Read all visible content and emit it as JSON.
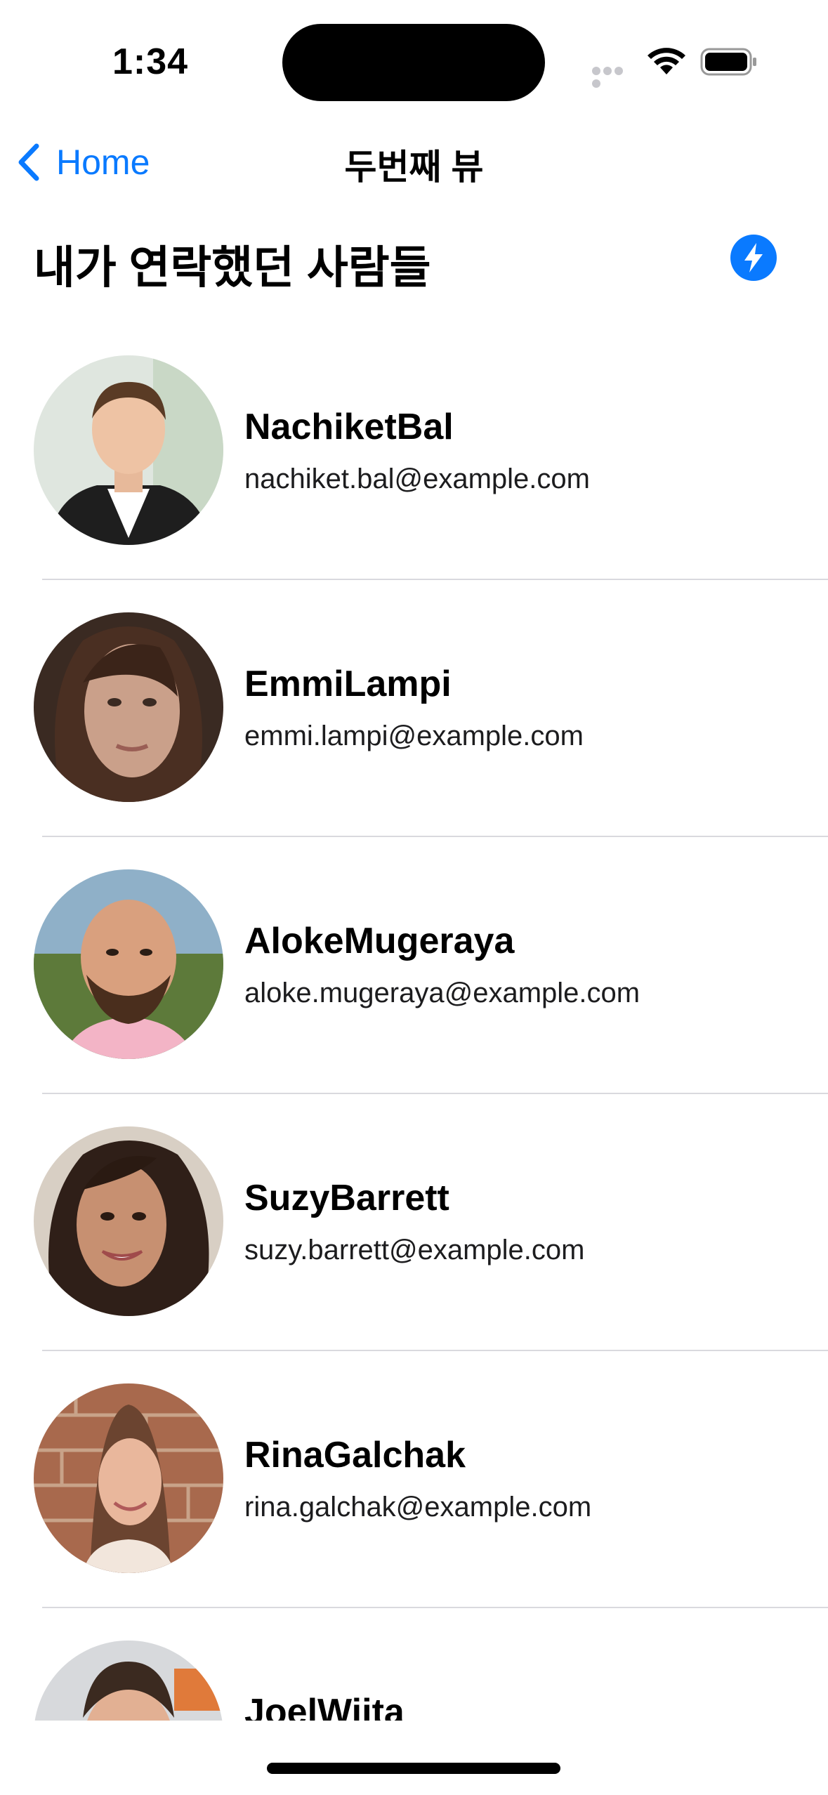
{
  "status_bar": {
    "time": "1:34"
  },
  "nav": {
    "back_label": "Home",
    "title": "두번째 뷰"
  },
  "header": {
    "title": "내가 연락했던 사람들",
    "action_icon": "bolt-icon"
  },
  "colors": {
    "accent": "#0a7aff",
    "divider": "#d9d9de",
    "background": "#ffffff"
  },
  "contacts": [
    {
      "name": "NachiketBal",
      "email": "nachiket.bal@example.com"
    },
    {
      "name": "EmmiLampi",
      "email": "emmi.lampi@example.com"
    },
    {
      "name": "AlokeMugeraya",
      "email": "aloke.mugeraya@example.com"
    },
    {
      "name": "SuzyBarrett",
      "email": "suzy.barrett@example.com"
    },
    {
      "name": "RinaGalchak",
      "email": "rina.galchak@example.com"
    },
    {
      "name": "JoelWiita",
      "email": ""
    }
  ]
}
